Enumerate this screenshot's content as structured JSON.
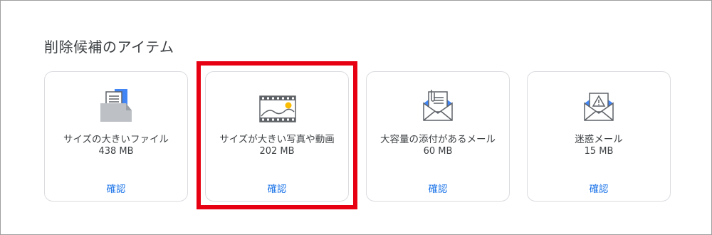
{
  "section": {
    "title": "削除候補のアイテム"
  },
  "cards": [
    {
      "label": "サイズの大きいファイル",
      "size": "438 MB",
      "action": "確認",
      "icon": "file-stack-icon"
    },
    {
      "label": "サイズが大きい写真や動画",
      "size": "202 MB",
      "action": "確認",
      "icon": "photo-video-icon"
    },
    {
      "label": "大容量の添付があるメール",
      "size": "60 MB",
      "action": "確認",
      "icon": "attachment-mail-icon"
    },
    {
      "label": "迷惑メール",
      "size": "15 MB",
      "action": "確認",
      "icon": "spam-mail-icon"
    }
  ],
  "colors": {
    "accent": "#1a73e8",
    "highlight": "#e60012",
    "icon_blue": "#4285f4",
    "icon_yellow": "#fbbc04"
  }
}
